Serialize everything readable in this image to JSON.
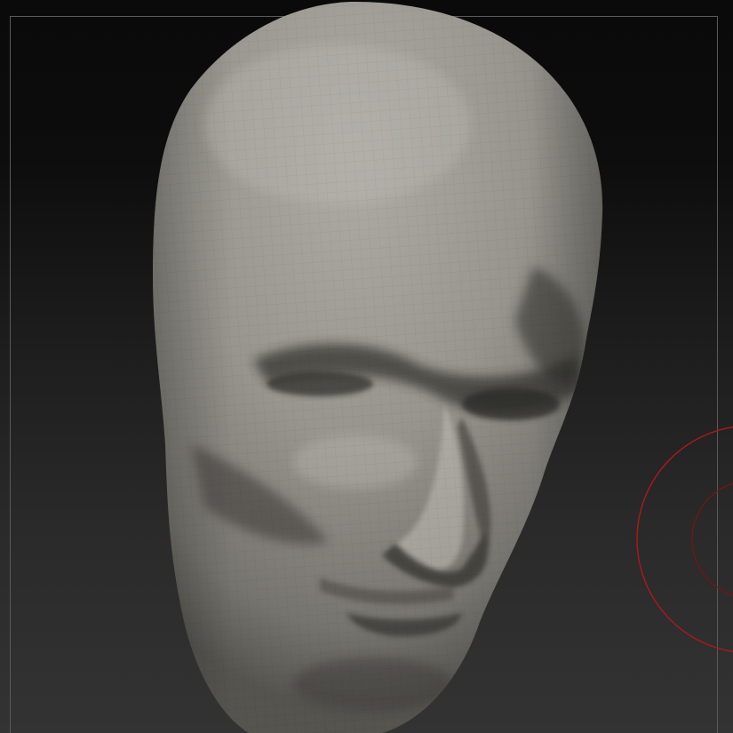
{
  "viewport": {
    "background_top": "#0a0a0a",
    "background_bottom": "#333333",
    "frame_color": "#5a5a5a"
  },
  "model": {
    "material_color": "#9a9891",
    "highlight_color": "#c4c2bc",
    "shadow_color": "#3c3b37"
  },
  "brush": {
    "outer_ring_color": "#b01818",
    "inner_ring_color": "#7a1414"
  }
}
